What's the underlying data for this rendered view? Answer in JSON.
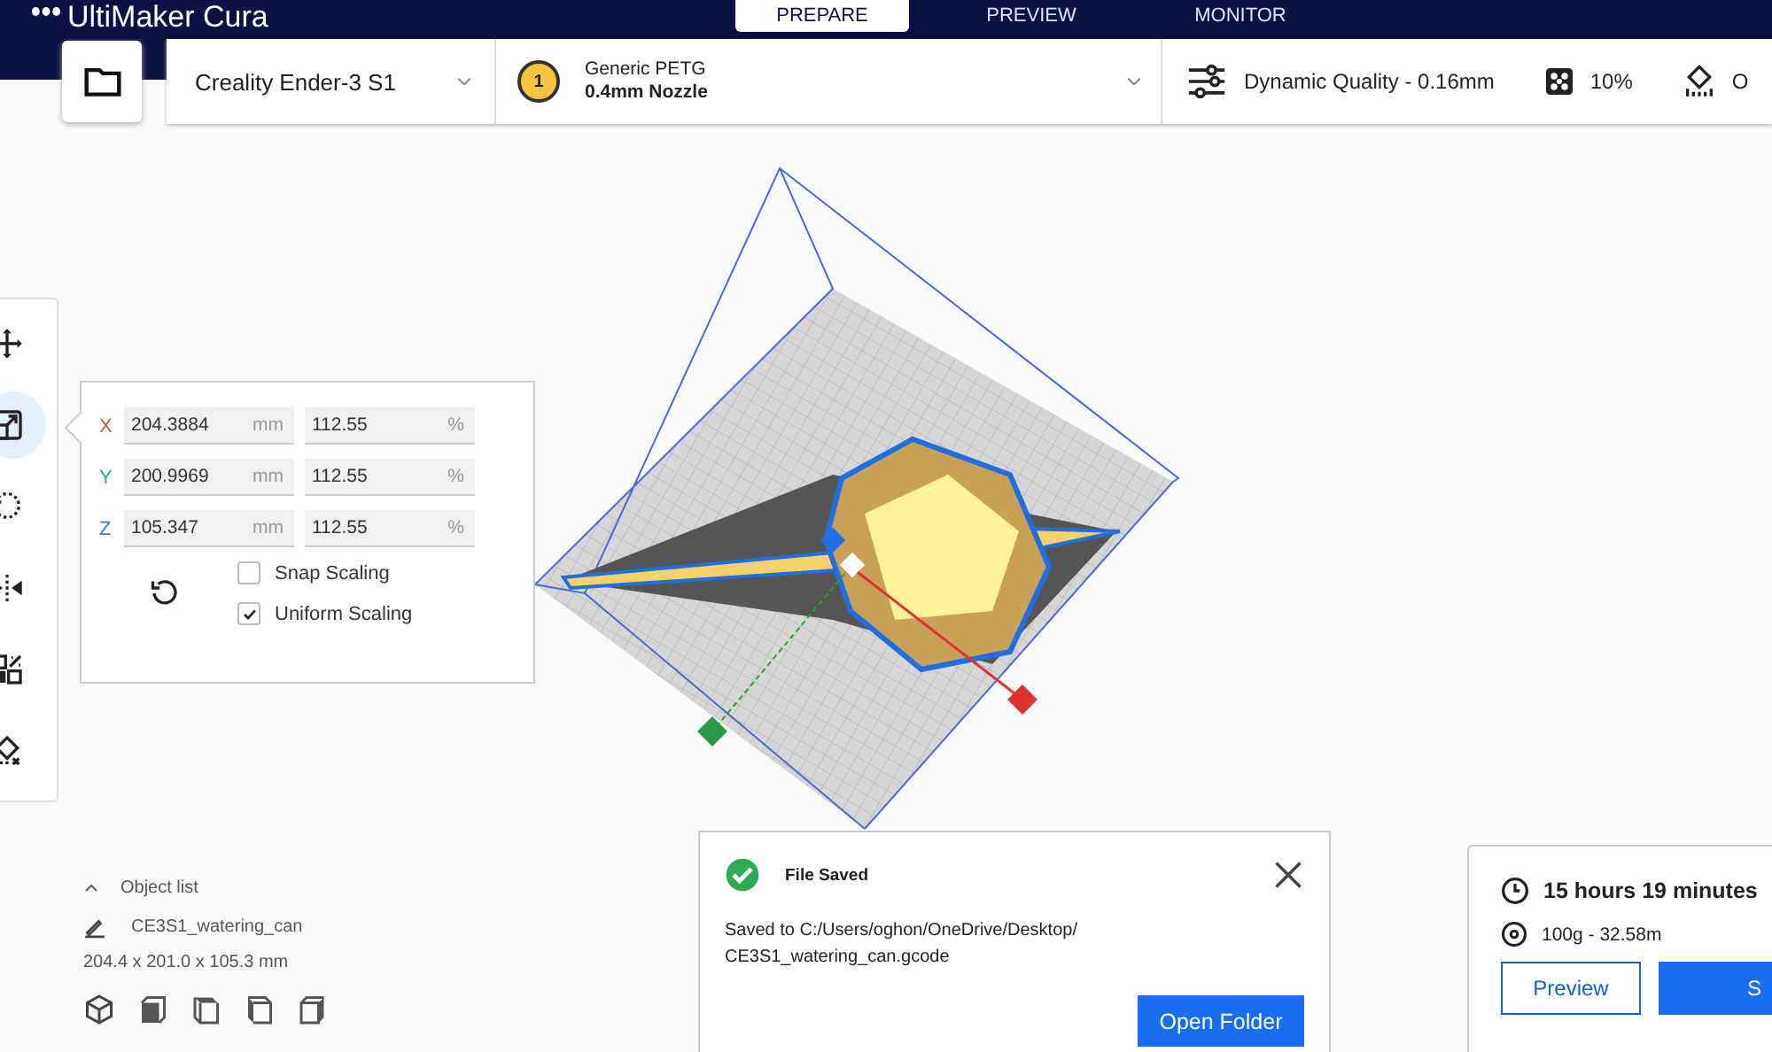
{
  "app": {
    "title": "UltiMaker Cura"
  },
  "stages": [
    {
      "label": "PREPARE",
      "selected": true
    },
    {
      "label": "PREVIEW",
      "selected": false
    },
    {
      "label": "MONITOR",
      "selected": false
    }
  ],
  "printer": {
    "name": "Creality Ender-3 S1"
  },
  "material": {
    "extruder": "1",
    "material": "Generic PETG",
    "nozzle": "0.4mm Nozzle"
  },
  "print_settings": {
    "profile": "Dynamic Quality - 0.16mm",
    "infill": "10%",
    "support": "O"
  },
  "tools": [
    {
      "kind": "move",
      "selected": false
    },
    {
      "kind": "scale",
      "selected": true
    },
    {
      "kind": "rotate",
      "selected": false
    },
    {
      "kind": "mirror",
      "selected": false
    },
    {
      "kind": "per-model",
      "selected": false
    },
    {
      "kind": "support-blocker",
      "selected": false
    }
  ],
  "scale_panel": {
    "axes": [
      {
        "axis": "X",
        "color": "#d9534f",
        "mm": "204.3884",
        "unit": "mm",
        "percent": "112.55",
        "percent_unit": "%"
      },
      {
        "axis": "Y",
        "color": "#3aa57a",
        "mm": "200.9969",
        "unit": "mm",
        "percent": "112.55",
        "percent_unit": "%"
      },
      {
        "axis": "Z",
        "color": "#3b7bbf",
        "mm": "105.347",
        "unit": "mm",
        "percent": "112.55",
        "percent_unit": "%"
      }
    ],
    "options": [
      {
        "label": "Snap Scaling",
        "checked": false
      },
      {
        "label": "Uniform Scaling",
        "checked": true
      }
    ]
  },
  "object_list": {
    "title": "Object list",
    "expanded": true,
    "object": "CE3S1_watering_can",
    "dimensions": "204.4 x 201.0 x 105.3 mm"
  },
  "camera_views": [
    {
      "kind": "iso"
    },
    {
      "kind": "front"
    },
    {
      "kind": "top"
    },
    {
      "kind": "left"
    },
    {
      "kind": "right"
    }
  ],
  "notification": {
    "title": "File Saved",
    "message_lines": [
      "Saved to C:/Users/oghon/OneDrive/Desktop/",
      "CE3S1_watering_can.gcode"
    ],
    "button": "Open Folder"
  },
  "print_info": {
    "time": "15 hours 19 minutes",
    "material": "100g - 32.58m",
    "buttons": [
      {
        "label": "Preview",
        "kind": "secondary"
      },
      {
        "label": "S",
        "kind": "primary"
      }
    ]
  }
}
